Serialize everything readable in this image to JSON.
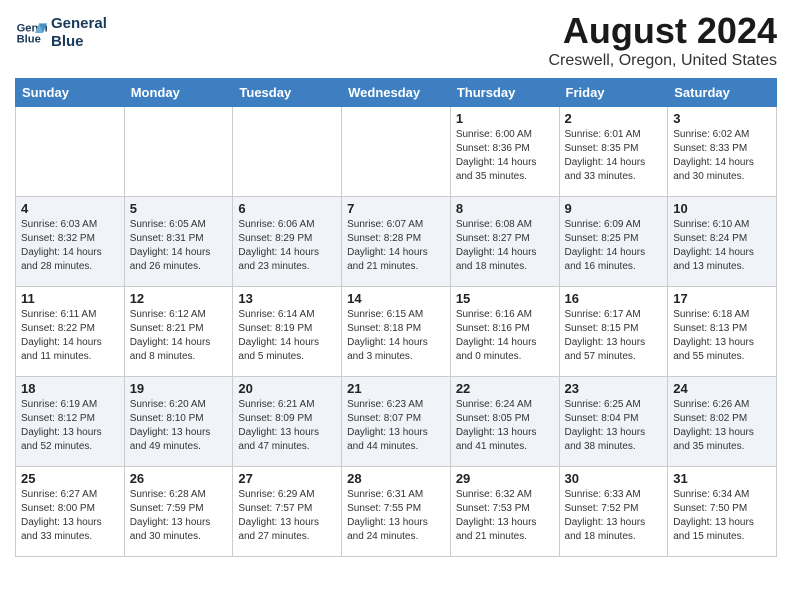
{
  "header": {
    "logo_line1": "General",
    "logo_line2": "Blue",
    "month_title": "August 2024",
    "location": "Creswell, Oregon, United States"
  },
  "days_of_week": [
    "Sunday",
    "Monday",
    "Tuesday",
    "Wednesday",
    "Thursday",
    "Friday",
    "Saturday"
  ],
  "weeks": [
    [
      {
        "day": "",
        "info": ""
      },
      {
        "day": "",
        "info": ""
      },
      {
        "day": "",
        "info": ""
      },
      {
        "day": "",
        "info": ""
      },
      {
        "day": "1",
        "info": "Sunrise: 6:00 AM\nSunset: 8:36 PM\nDaylight: 14 hours\nand 35 minutes."
      },
      {
        "day": "2",
        "info": "Sunrise: 6:01 AM\nSunset: 8:35 PM\nDaylight: 14 hours\nand 33 minutes."
      },
      {
        "day": "3",
        "info": "Sunrise: 6:02 AM\nSunset: 8:33 PM\nDaylight: 14 hours\nand 30 minutes."
      }
    ],
    [
      {
        "day": "4",
        "info": "Sunrise: 6:03 AM\nSunset: 8:32 PM\nDaylight: 14 hours\nand 28 minutes."
      },
      {
        "day": "5",
        "info": "Sunrise: 6:05 AM\nSunset: 8:31 PM\nDaylight: 14 hours\nand 26 minutes."
      },
      {
        "day": "6",
        "info": "Sunrise: 6:06 AM\nSunset: 8:29 PM\nDaylight: 14 hours\nand 23 minutes."
      },
      {
        "day": "7",
        "info": "Sunrise: 6:07 AM\nSunset: 8:28 PM\nDaylight: 14 hours\nand 21 minutes."
      },
      {
        "day": "8",
        "info": "Sunrise: 6:08 AM\nSunset: 8:27 PM\nDaylight: 14 hours\nand 18 minutes."
      },
      {
        "day": "9",
        "info": "Sunrise: 6:09 AM\nSunset: 8:25 PM\nDaylight: 14 hours\nand 16 minutes."
      },
      {
        "day": "10",
        "info": "Sunrise: 6:10 AM\nSunset: 8:24 PM\nDaylight: 14 hours\nand 13 minutes."
      }
    ],
    [
      {
        "day": "11",
        "info": "Sunrise: 6:11 AM\nSunset: 8:22 PM\nDaylight: 14 hours\nand 11 minutes."
      },
      {
        "day": "12",
        "info": "Sunrise: 6:12 AM\nSunset: 8:21 PM\nDaylight: 14 hours\nand 8 minutes."
      },
      {
        "day": "13",
        "info": "Sunrise: 6:14 AM\nSunset: 8:19 PM\nDaylight: 14 hours\nand 5 minutes."
      },
      {
        "day": "14",
        "info": "Sunrise: 6:15 AM\nSunset: 8:18 PM\nDaylight: 14 hours\nand 3 minutes."
      },
      {
        "day": "15",
        "info": "Sunrise: 6:16 AM\nSunset: 8:16 PM\nDaylight: 14 hours\nand 0 minutes."
      },
      {
        "day": "16",
        "info": "Sunrise: 6:17 AM\nSunset: 8:15 PM\nDaylight: 13 hours\nand 57 minutes."
      },
      {
        "day": "17",
        "info": "Sunrise: 6:18 AM\nSunset: 8:13 PM\nDaylight: 13 hours\nand 55 minutes."
      }
    ],
    [
      {
        "day": "18",
        "info": "Sunrise: 6:19 AM\nSunset: 8:12 PM\nDaylight: 13 hours\nand 52 minutes."
      },
      {
        "day": "19",
        "info": "Sunrise: 6:20 AM\nSunset: 8:10 PM\nDaylight: 13 hours\nand 49 minutes."
      },
      {
        "day": "20",
        "info": "Sunrise: 6:21 AM\nSunset: 8:09 PM\nDaylight: 13 hours\nand 47 minutes."
      },
      {
        "day": "21",
        "info": "Sunrise: 6:23 AM\nSunset: 8:07 PM\nDaylight: 13 hours\nand 44 minutes."
      },
      {
        "day": "22",
        "info": "Sunrise: 6:24 AM\nSunset: 8:05 PM\nDaylight: 13 hours\nand 41 minutes."
      },
      {
        "day": "23",
        "info": "Sunrise: 6:25 AM\nSunset: 8:04 PM\nDaylight: 13 hours\nand 38 minutes."
      },
      {
        "day": "24",
        "info": "Sunrise: 6:26 AM\nSunset: 8:02 PM\nDaylight: 13 hours\nand 35 minutes."
      }
    ],
    [
      {
        "day": "25",
        "info": "Sunrise: 6:27 AM\nSunset: 8:00 PM\nDaylight: 13 hours\nand 33 minutes."
      },
      {
        "day": "26",
        "info": "Sunrise: 6:28 AM\nSunset: 7:59 PM\nDaylight: 13 hours\nand 30 minutes."
      },
      {
        "day": "27",
        "info": "Sunrise: 6:29 AM\nSunset: 7:57 PM\nDaylight: 13 hours\nand 27 minutes."
      },
      {
        "day": "28",
        "info": "Sunrise: 6:31 AM\nSunset: 7:55 PM\nDaylight: 13 hours\nand 24 minutes."
      },
      {
        "day": "29",
        "info": "Sunrise: 6:32 AM\nSunset: 7:53 PM\nDaylight: 13 hours\nand 21 minutes."
      },
      {
        "day": "30",
        "info": "Sunrise: 6:33 AM\nSunset: 7:52 PM\nDaylight: 13 hours\nand 18 minutes."
      },
      {
        "day": "31",
        "info": "Sunrise: 6:34 AM\nSunset: 7:50 PM\nDaylight: 13 hours\nand 15 minutes."
      }
    ]
  ]
}
